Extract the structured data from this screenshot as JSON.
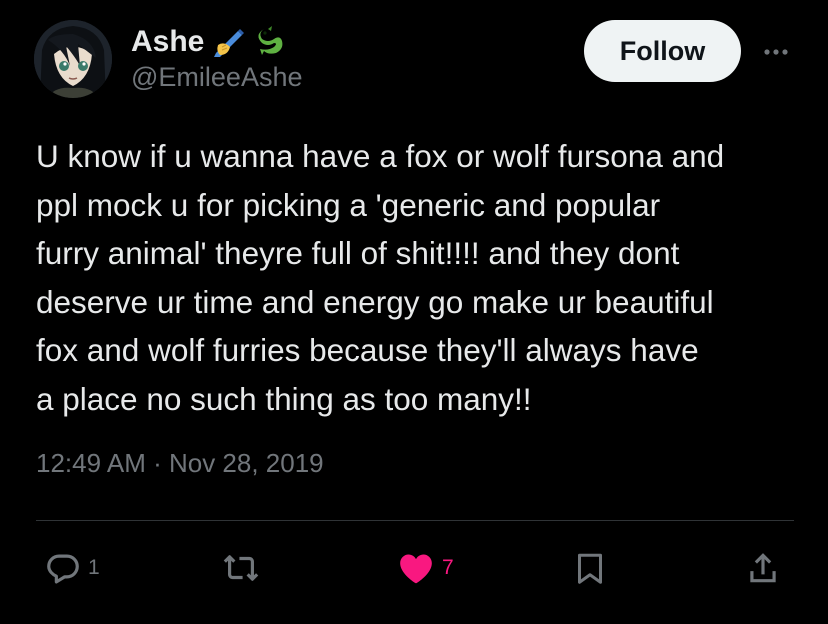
{
  "user": {
    "display_name": "Ashe",
    "name_emojis": [
      "writing-hand-emoji",
      "dragon-emoji"
    ],
    "handle": "@EmileeAshe"
  },
  "header": {
    "follow_label": "Follow",
    "more_icon": "more-dots-icon"
  },
  "tweet": {
    "text": "U know if u wanna have a fox or wolf fursona and\nppl mock u for picking a 'generic and popular\nfurry animal' theyre full of shit!!!! and they dont\ndeserve ur time and energy go make ur beautiful\nfox and wolf furries because they'll always have\na place no such thing as too many!!",
    "timestamp": "12:49 AM · Nov 28, 2019"
  },
  "actions": {
    "reply": {
      "icon": "reply-icon",
      "count": "1"
    },
    "retweet": {
      "icon": "retweet-icon",
      "count": ""
    },
    "like": {
      "icon": "heart-icon",
      "count": "7",
      "liked": true
    },
    "bookmark": {
      "icon": "bookmark-icon"
    },
    "share": {
      "icon": "share-icon"
    }
  },
  "colors": {
    "background": "#000000",
    "text_primary": "#e7e9ea",
    "text_secondary": "#71767b",
    "like_pink": "#f91880",
    "follow_bg": "#eff3f4"
  }
}
